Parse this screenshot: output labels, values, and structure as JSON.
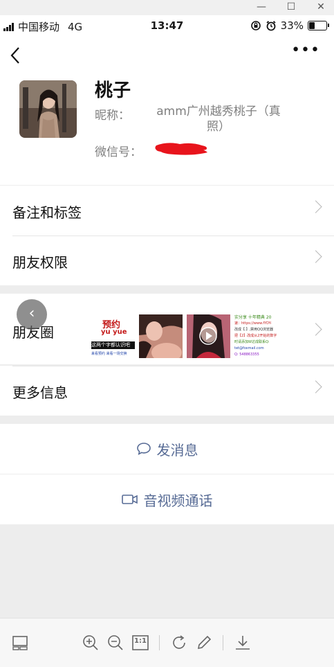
{
  "window": {
    "minimize_glyph": "—",
    "maximize_glyph": "☐",
    "close_glyph": "✕"
  },
  "status_bar": {
    "carrier": "中国移动",
    "network": "4G",
    "time": "13:47",
    "battery": "33%",
    "battery_level": 0.33
  },
  "nav": {
    "back_glyph": "‹",
    "more_glyph": "•••"
  },
  "profile": {
    "name": "桃子",
    "nickname_label": "昵称：",
    "nickname_value": "amm广州越秀桃子（真照）",
    "wechat_id_label": "微信号："
  },
  "menu": {
    "remark_tags": "备注和标签",
    "friend_permissions": "朋友权限",
    "moments": "朋友圈",
    "more_info": "更多信息"
  },
  "moments_thumbs": {
    "t1_title": "预约",
    "t1_sub": "yu yue",
    "t1_line1": "这两个字都认识吧",
    "t1_line2": "来看预约 来看一场交换",
    "t4_line1": "实分享 十年精典 20",
    "t4_line2": "速：https://www.fYDY-",
    "t4_line3": "改成【.】,禁用QQ浏览器",
    "t4_line4": "把【2】改成从2开始的数字",
    "t4_line5": "时请添加W达成联系Q:",
    "t4_line6": "tet@foxmail.com",
    "t4_line7": "Q: 548863355"
  },
  "actions": {
    "send_message": "发消息",
    "video_call": "音视频通话"
  },
  "floating_back_glyph": "‹",
  "colors": {
    "link_blue": "#576b95",
    "redaction_red": "#e8141c"
  },
  "toolbar_icons": [
    "layout-icon",
    "zoom-in-icon",
    "zoom-out-icon",
    "actual-size-icon",
    "rotate-icon",
    "edit-icon",
    "download-icon"
  ],
  "toolbar": {
    "actual_size_label": "1:1"
  }
}
